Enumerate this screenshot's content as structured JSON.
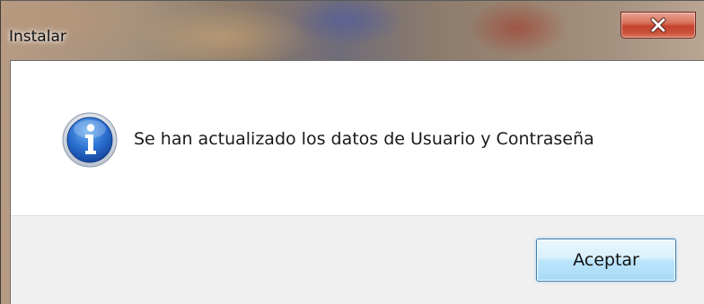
{
  "window": {
    "title": "Instalar"
  },
  "titlebar": {
    "close_icon": "close-icon"
  },
  "message": {
    "icon": "info-icon",
    "text": "Se han actualizado los datos de Usuario y Contraseña"
  },
  "buttons": {
    "accept_label": "Aceptar"
  },
  "colors": {
    "close_button": "#c5432d",
    "info_icon": "#1f5fb8",
    "button_area": "#f0f0f0",
    "accept_border": "#3c7fb1"
  }
}
